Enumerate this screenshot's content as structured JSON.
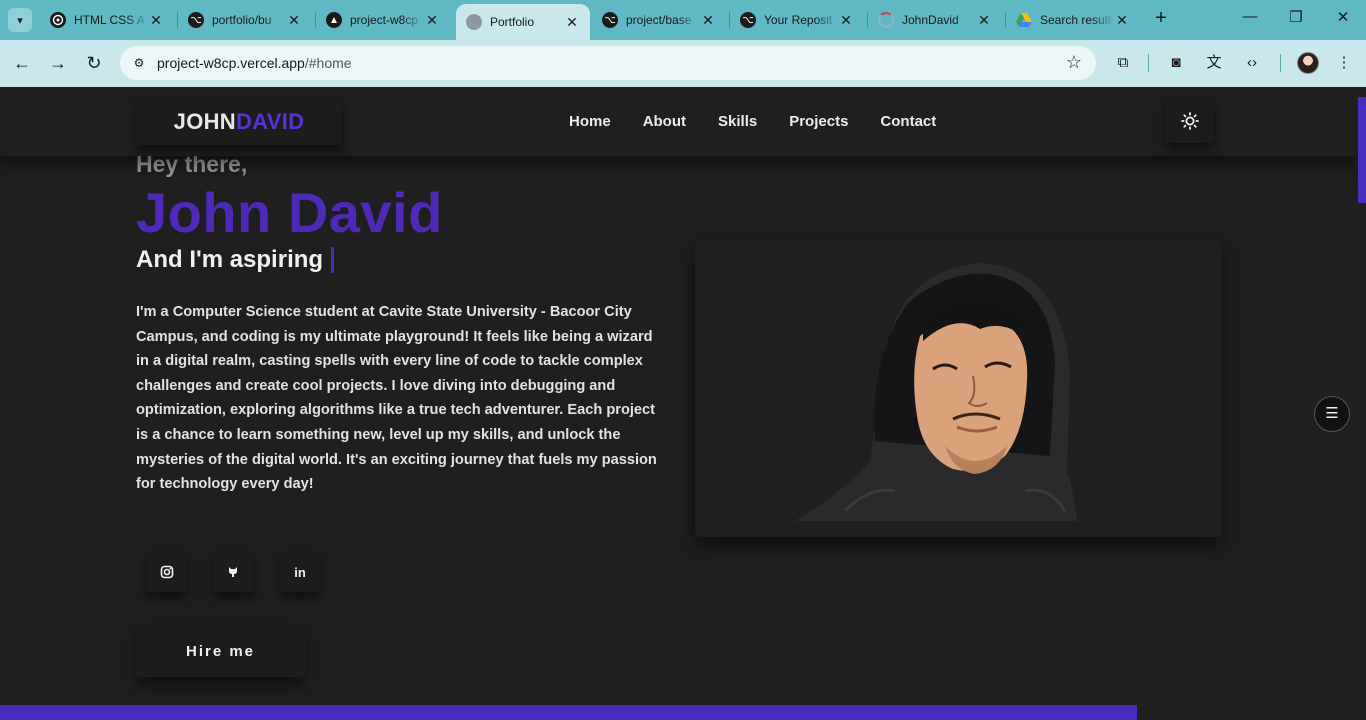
{
  "browser": {
    "tabs": [
      {
        "title": "HTML CSS A",
        "icon": "chatgpt-icon"
      },
      {
        "title": "portfolio/bu",
        "icon": "github-icon"
      },
      {
        "title": "project-w8cp",
        "icon": "vercel-icon"
      },
      {
        "title": "Portfolio",
        "icon": "globe-icon",
        "active": true
      },
      {
        "title": "project/base",
        "icon": "github-icon"
      },
      {
        "title": "Your Reposit",
        "icon": "github-icon"
      },
      {
        "title": "JohnDavid",
        "icon": "loading-icon"
      },
      {
        "title": "Search result",
        "icon": "google-drive-icon"
      }
    ],
    "url_host": "project-w8cp.vercel.app",
    "url_path": "/#home"
  },
  "site": {
    "logo_first": "JOHN",
    "logo_second": "DAVID",
    "nav": [
      "Home",
      "About",
      "Skills",
      "Projects",
      "Contact"
    ],
    "theme_icon": "sun-icon"
  },
  "hero": {
    "greeting": "Hey there,",
    "name": "John David",
    "tagline": "And I'm aspiring",
    "bio": "I'm a Computer Science student at Cavite State University - Bacoor City Campus, and coding is my ultimate playground! It feels like being a wizard in a digital realm, casting spells with every line of code to tackle complex challenges and create cool projects. I love diving into debugging and optimization, exploring algorithms like a true tech adventurer. Each project is a chance to learn something new, level up my skills, and unlock the mysteries of the digital world. It's an exciting journey that fuels my passion for technology every day!",
    "socials": [
      "instagram-icon",
      "github-icon",
      "linkedin-icon"
    ],
    "hire_label": "Hire me"
  },
  "colors": {
    "accent": "#4f2ab8",
    "background": "#1f1f1f",
    "browser_frame": "#5fb8c4"
  }
}
